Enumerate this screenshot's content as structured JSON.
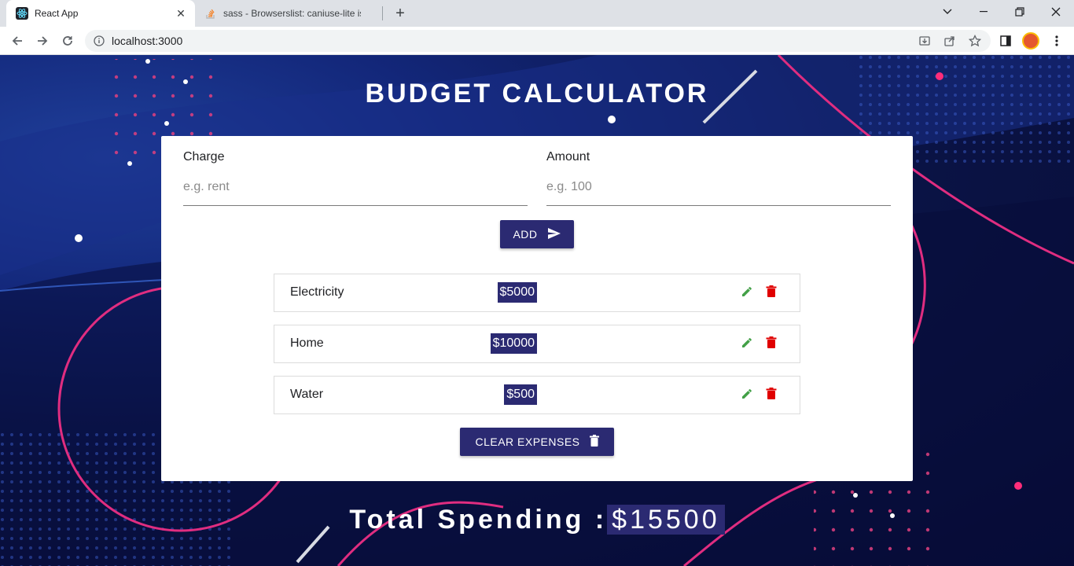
{
  "browser": {
    "tabs": [
      {
        "title": "React App",
        "icon": "react-icon",
        "active": true
      },
      {
        "title": "sass - Browserslist: caniuse-lite is",
        "icon": "stackoverflow-icon",
        "active": false
      }
    ],
    "address": "localhost:3000",
    "colors": {
      "tabstrip": "#dee1e6",
      "toolbar": "#ffffff"
    }
  },
  "app": {
    "title": "BUDGET CALCULATOR",
    "form": {
      "charge_label": "Charge",
      "charge_placeholder": "e.g. rent",
      "charge_value": "",
      "amount_label": "Amount",
      "amount_placeholder": "e.g. 100",
      "amount_value": ""
    },
    "add_button": {
      "label": "ADD",
      "icon": "send-icon"
    },
    "expenses": [
      {
        "charge": "Electricity",
        "amount": "$5000"
      },
      {
        "charge": "Home",
        "amount": "$10000"
      },
      {
        "charge": "Water",
        "amount": "$500"
      }
    ],
    "clear_button": {
      "label": "CLEAR EXPENSES",
      "icon": "trash-icon"
    },
    "total": {
      "label": "Total Spending :",
      "amount": "$15500"
    },
    "colors": {
      "accent": "#2b2a72",
      "edit": "#43a047",
      "delete": "#e00000",
      "background": "#0b1447"
    }
  }
}
